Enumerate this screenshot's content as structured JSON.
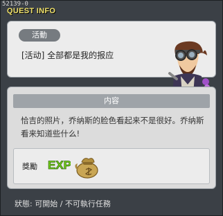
{
  "window": {
    "quest_id": "52139-0",
    "title": "QUEST INFO"
  },
  "quest": {
    "category": "活動",
    "name": "[活动] 全部都是我的报应"
  },
  "main": {
    "section_title": "内容",
    "description": "恰吉的照片，乔纳斯的脸色看起来不是很好。乔纳斯看来知道些什么!"
  },
  "reward": {
    "label": "獎勵",
    "icons": [
      "exp-icon",
      "money-bag-icon"
    ]
  },
  "status": {
    "text": "狀態: 可開始 / 不可執行任務"
  },
  "colors": {
    "window_bg": "#3b4046",
    "title_text": "#f1e26a",
    "panel_bg": "#ececec",
    "section_bar": "#9ea3a8"
  }
}
